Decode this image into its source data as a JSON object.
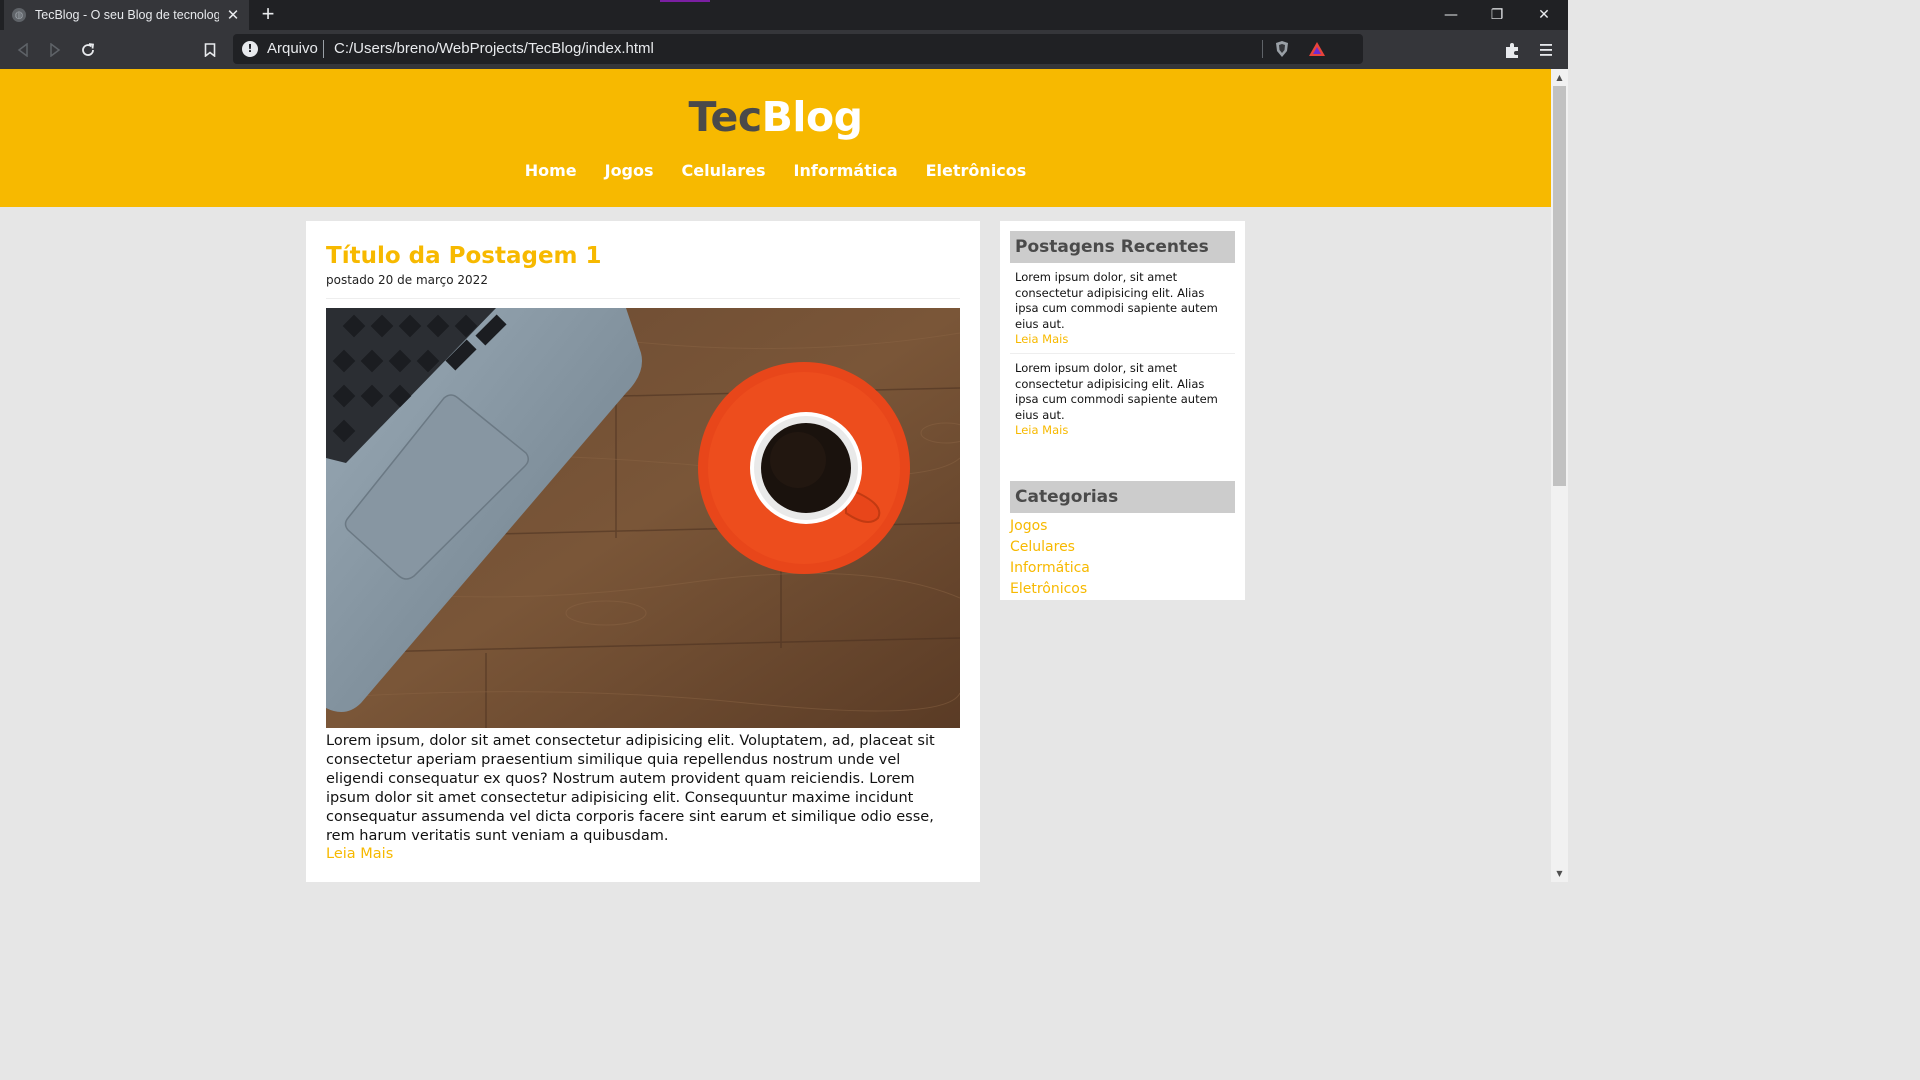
{
  "browser": {
    "tab_title": "TecBlog - O seu Blog de tecnologia",
    "tab_close": "✕",
    "new_tab": "+",
    "scheme_label": "Arquivo",
    "url": "C:/Users/breno/WebProjects/TecBlog/index.html",
    "window_controls": {
      "minimize": "—",
      "restore": "❐",
      "close": "✕"
    }
  },
  "site": {
    "logo_part1": "Tec",
    "logo_part2": "Blog",
    "nav": [
      "Home",
      "Jogos",
      "Celulares",
      "Informática",
      "Eletrônicos"
    ]
  },
  "post": {
    "title": "Título da Postagem 1",
    "date": "postado 20 de março 2022",
    "body": "Lorem ipsum, dolor sit amet consectetur adipisicing elit. Voluptatem, ad, placeat sit consectetur aperiam praesentium similique quia repellendus nostrum unde vel eligendi consequatur ex quos? Nostrum autem provident quam reiciendis. Lorem ipsum dolor sit amet consectetur adipisicing elit. Consequuntur maxime incidunt consequatur assumenda vel dicta corporis facere sint earum et similique odio esse, rem harum veritatis sunt veniam a quibusdam.",
    "read_more": "Leia Mais"
  },
  "sidebar": {
    "recent_title": "Postagens Recentes",
    "recent_items": [
      {
        "text": "Lorem ipsum dolor, sit amet consectetur adipisicing elit. Alias ipsa cum commodi sapiente autem eius aut.",
        "link": "Leia Mais"
      },
      {
        "text": "Lorem ipsum dolor, sit amet consectetur adipisicing elit. Alias ipsa cum commodi sapiente autem eius aut.",
        "link": "Leia Mais"
      }
    ],
    "categories_title": "Categorias",
    "categories": [
      "Jogos",
      "Celulares",
      "Informática",
      "Eletrônicos"
    ]
  },
  "colors": {
    "brand_yellow": "#f7b900",
    "logo_dark": "#4a4a4a",
    "page_bg": "#e6e6e6",
    "widget_header": "#cccccc"
  }
}
